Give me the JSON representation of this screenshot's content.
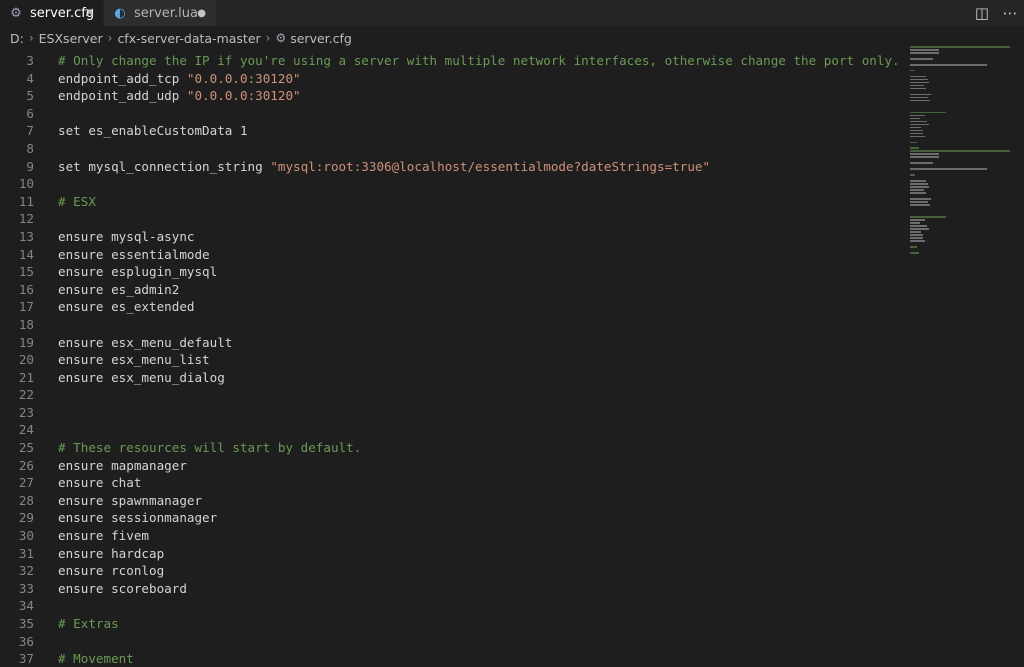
{
  "tabs": [
    {
      "label": "server.cfg",
      "icon": "gear-icon",
      "active": true,
      "close": "✕"
    },
    {
      "label": "server.lua",
      "icon": "lua-file-icon",
      "active": false,
      "dirty": "●"
    }
  ],
  "tab_actions": {
    "split": "◫",
    "more": "⋯"
  },
  "breadcrumb": {
    "parts": [
      "D:",
      "ESXserver",
      "cfx-server-data-master",
      "server.cfg"
    ],
    "separator": "›"
  },
  "editor": {
    "lines": [
      {
        "n": "3",
        "text": "# Only change the IP if you're using a server with multiple network interfaces, otherwise change the port only.",
        "kind": "comment"
      },
      {
        "n": "4",
        "text": "endpoint_add_tcp ",
        "str": "\"0.0.0.0:30120\"",
        "kind": "code"
      },
      {
        "n": "5",
        "text": "endpoint_add_udp ",
        "str": "\"0.0.0.0:30120\"",
        "kind": "code"
      },
      {
        "n": "6",
        "text": "",
        "kind": "code"
      },
      {
        "n": "7",
        "text": "set es_enableCustomData 1",
        "kind": "code"
      },
      {
        "n": "8",
        "text": "",
        "kind": "code"
      },
      {
        "n": "9",
        "text": "set mysql_connection_string ",
        "str": "\"mysql:root:3306@localhost/essentialmode?dateStrings=true\"",
        "kind": "code"
      },
      {
        "n": "10",
        "text": "",
        "kind": "code"
      },
      {
        "n": "11",
        "text": "# ESX",
        "kind": "comment"
      },
      {
        "n": "12",
        "text": "",
        "kind": "code"
      },
      {
        "n": "13",
        "text": "ensure mysql-async",
        "kind": "code"
      },
      {
        "n": "14",
        "text": "ensure essentialmode",
        "kind": "code"
      },
      {
        "n": "15",
        "text": "ensure esplugin_mysql",
        "kind": "code"
      },
      {
        "n": "16",
        "text": "ensure es_admin2",
        "kind": "code"
      },
      {
        "n": "17",
        "text": "ensure es_extended",
        "kind": "code"
      },
      {
        "n": "18",
        "text": "",
        "kind": "code"
      },
      {
        "n": "19",
        "text": "ensure esx_menu_default",
        "kind": "code"
      },
      {
        "n": "20",
        "text": "ensure esx_menu_list",
        "kind": "code"
      },
      {
        "n": "21",
        "text": "ensure esx_menu_dialog",
        "kind": "code"
      },
      {
        "n": "22",
        "text": "",
        "kind": "code"
      },
      {
        "n": "23",
        "text": "",
        "kind": "code"
      },
      {
        "n": "24",
        "text": "",
        "kind": "code"
      },
      {
        "n": "25",
        "text": "# These resources will start by default.",
        "kind": "comment"
      },
      {
        "n": "26",
        "text": "ensure mapmanager",
        "kind": "code"
      },
      {
        "n": "27",
        "text": "ensure chat",
        "kind": "code"
      },
      {
        "n": "28",
        "text": "ensure spawnmanager",
        "kind": "code"
      },
      {
        "n": "29",
        "text": "ensure sessionmanager",
        "kind": "code"
      },
      {
        "n": "30",
        "text": "ensure fivem",
        "kind": "code"
      },
      {
        "n": "31",
        "text": "ensure hardcap",
        "kind": "code"
      },
      {
        "n": "32",
        "text": "ensure rconlog",
        "kind": "code"
      },
      {
        "n": "33",
        "text": "ensure scoreboard",
        "kind": "code"
      },
      {
        "n": "34",
        "text": "",
        "kind": "code"
      },
      {
        "n": "35",
        "text": "# Extras",
        "kind": "comment"
      },
      {
        "n": "36",
        "text": "",
        "kind": "code"
      },
      {
        "n": "37",
        "text": "# Movement",
        "kind": "comment"
      }
    ]
  },
  "colors": {
    "background": "#1e1e1e",
    "comment": "#6a9955",
    "string": "#ce9178",
    "text": "#d4d4d4",
    "line_number": "#858585"
  }
}
